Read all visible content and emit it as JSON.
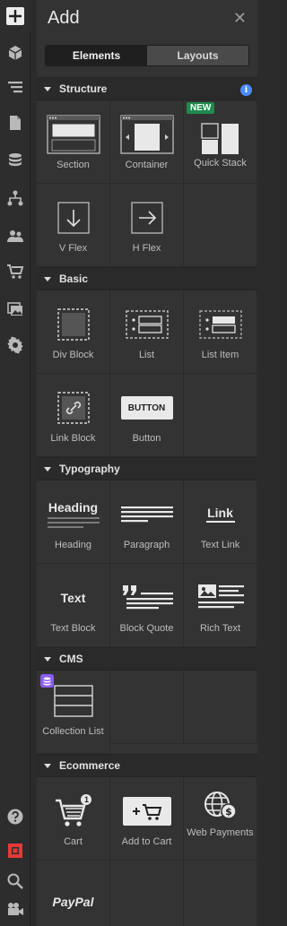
{
  "panel": {
    "title": "Add"
  },
  "tabs": [
    {
      "label": "Elements",
      "active": true
    },
    {
      "label": "Layouts",
      "active": false
    }
  ],
  "rail": {
    "top": [
      "plus-icon",
      "cube-icon",
      "navigator-icon",
      "pages-icon",
      "database-icon",
      "symbols-icon",
      "users-icon",
      "ecommerce-cart-icon",
      "assets-icon",
      "settings-gear-icon"
    ],
    "bottom": [
      "help-icon",
      "record-icon",
      "search-icon",
      "video-icon"
    ]
  },
  "sections": {
    "structure": {
      "label": "Structure",
      "items": [
        "Section",
        "Container",
        "Quick Stack",
        "V Flex",
        "H Flex"
      ],
      "new_badge": "NEW"
    },
    "basic": {
      "label": "Basic",
      "items": [
        "Div Block",
        "List",
        "List Item",
        "Link Block",
        "Button"
      ],
      "button_preview": "BUTTON"
    },
    "typography": {
      "label": "Typography",
      "items": [
        "Heading",
        "Paragraph",
        "Text Link",
        "Text Block",
        "Block Quote",
        "Rich Text"
      ],
      "heading_preview": "Heading",
      "link_preview": "Link",
      "text_preview": "Text"
    },
    "cms": {
      "label": "CMS",
      "items": [
        "Collection List"
      ]
    },
    "ecommerce": {
      "label": "Ecommerce",
      "items": [
        "Cart",
        "Add to Cart",
        "Web Payments"
      ],
      "cart_count": "1",
      "paypal_label": "PayPal"
    }
  },
  "colors": {
    "accent_new": "#1f8a4c",
    "info": "#4a8cff",
    "cms_badge": "#8b5cf6"
  }
}
